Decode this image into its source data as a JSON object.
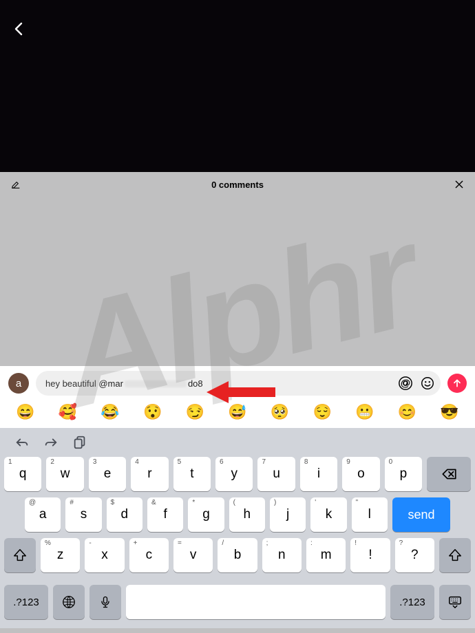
{
  "nav": {
    "back_label": "Back"
  },
  "watermark_text": "Alphr",
  "comments": {
    "header_title": "0 comments",
    "avatar_initial": "a",
    "input_text_prefix": "hey beautiful ",
    "input_mention_prefix": "@mar",
    "input_mention_suffix": "do8",
    "mention_icon_label": "@",
    "emoji_icon_label": "emoji",
    "send_label": "send"
  },
  "emoji_row": [
    "😄",
    "🥰",
    "😂",
    "😯",
    "😏",
    "😅",
    "🥺",
    "😌",
    "😬",
    "😊",
    "😎"
  ],
  "arrow": {
    "color": "#e62222"
  },
  "keyboard": {
    "row1_hints": [
      "1",
      "2",
      "3",
      "4",
      "5",
      "6",
      "7",
      "8",
      "9",
      "0"
    ],
    "row1": [
      "q",
      "w",
      "e",
      "r",
      "t",
      "y",
      "u",
      "i",
      "o",
      "p"
    ],
    "row2_hints": [
      "@",
      "#",
      "$",
      "&",
      "*",
      "(",
      ")",
      "'",
      "\""
    ],
    "row2": [
      "a",
      "s",
      "d",
      "f",
      "g",
      "h",
      "j",
      "k",
      "l"
    ],
    "send_label": "send",
    "row3_hints": [
      "%",
      "-",
      "+",
      "=",
      "/",
      ";",
      ":",
      "!",
      "?"
    ],
    "row3": [
      "z",
      "x",
      "c",
      "v",
      "b",
      "n",
      "m",
      "!",
      "?"
    ],
    "numkey_label": ".?123",
    "globe_label": "globe",
    "mic_label": "mic",
    "dismiss_label": "hide"
  }
}
